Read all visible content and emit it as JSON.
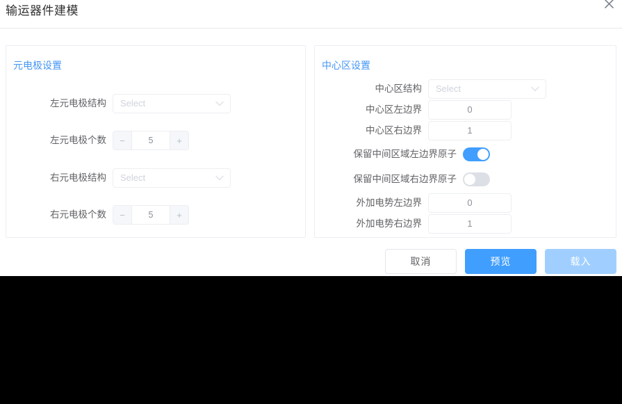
{
  "dialog": {
    "title": "输运器件建模",
    "close_icon": "close-icon"
  },
  "left_panel": {
    "title": "元电极设置",
    "fields": [
      {
        "label": "左元电极结构",
        "type": "select",
        "value": "",
        "placeholder": "Select"
      },
      {
        "label": "左元电极个数",
        "type": "stepper",
        "value": "5",
        "minus": "−",
        "plus": "+"
      },
      {
        "label": "右元电极结构",
        "type": "select",
        "value": "",
        "placeholder": "Select"
      },
      {
        "label": "右元电极个数",
        "type": "stepper",
        "value": "5",
        "minus": "−",
        "plus": "+"
      }
    ]
  },
  "right_panel": {
    "title": "中心区设置",
    "fields": [
      {
        "label": "中心区结构",
        "type": "select",
        "value": "",
        "placeholder": "Select"
      },
      {
        "label": "中心区左边界",
        "type": "number",
        "value": "0"
      },
      {
        "label": "中心区右边界",
        "type": "number",
        "value": "1"
      },
      {
        "label": "保留中间区域左边界原子",
        "type": "switch",
        "value": "on"
      },
      {
        "label": "保留中间区域右边界原子",
        "type": "switch",
        "value": "off"
      },
      {
        "label": "外加电势左边界",
        "type": "number",
        "value": "0"
      },
      {
        "label": "外加电势右边界",
        "type": "number",
        "value": "1"
      }
    ]
  },
  "footer": {
    "cancel_label": "取消",
    "preview_label": "预览",
    "load_label": "载入"
  },
  "colors": {
    "accent": "#409eff",
    "panel_title": "#4596f5",
    "load_disabled": "#a0cfff",
    "viewport_bg": "#000000",
    "border": "#ebeef5"
  }
}
